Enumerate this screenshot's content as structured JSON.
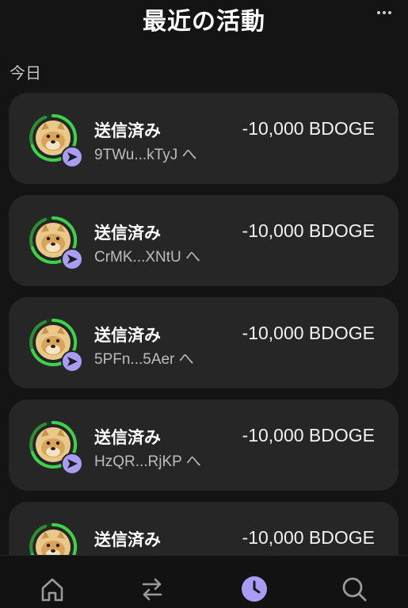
{
  "header": {
    "title": "最近の活動"
  },
  "section": {
    "label": "今日"
  },
  "items": [
    {
      "status": "送信済み",
      "address": "9TWu...kTyJ へ",
      "amount": "-10,000 BDOGE"
    },
    {
      "status": "送信済み",
      "address": "CrMK...XNtU へ",
      "amount": "-10,000 BDOGE"
    },
    {
      "status": "送信済み",
      "address": "5PFn...5Aer へ",
      "amount": "-10,000 BDOGE"
    },
    {
      "status": "送信済み",
      "address": "HzQR...RjKP へ",
      "amount": "-10,000 BDOGE"
    },
    {
      "status": "送信済み",
      "address": "",
      "amount": "-10,000 BDOGE"
    }
  ],
  "nav": [
    "home-icon",
    "swap-icon",
    "history-icon",
    "search-icon"
  ],
  "colors": {
    "accent": "#a89cf5",
    "ring": "#3ed24a",
    "card": "#262626",
    "background": "#141414"
  }
}
